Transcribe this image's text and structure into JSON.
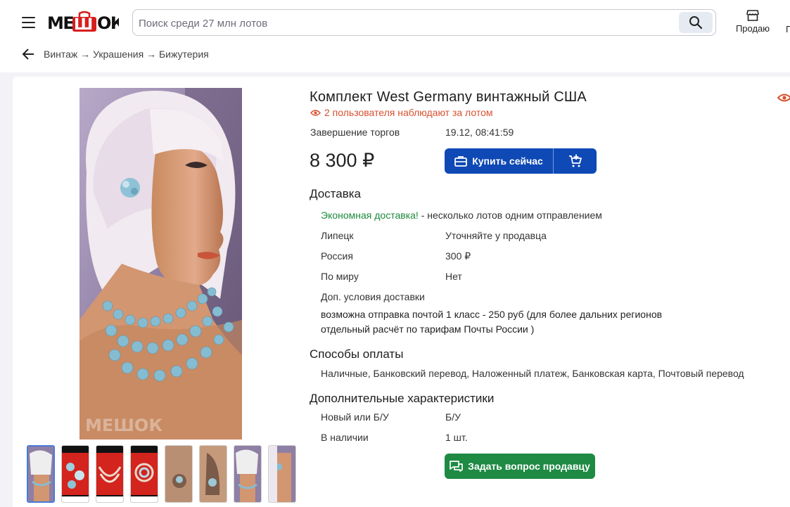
{
  "header": {
    "logo": "МЕШОК",
    "search_placeholder": "Поиск среди 27 млн лотов",
    "sell_label": "Продаю",
    "cutoff_label": "Г"
  },
  "breadcrumb": {
    "path": "Винтаж → Украшения → Бижутерия"
  },
  "lot": {
    "title": "Комплект West Germany винтажный США",
    "watchers": "2 пользователя наблюдают за лотом",
    "end_label": "Завершение торгов",
    "end_value": "19.12, 08:41:59",
    "price": "8 300 ₽",
    "buy_label": "Купить сейчас",
    "photo_watermark": "МЕШОК"
  },
  "delivery": {
    "heading": "Доставка",
    "economy_link": "Экономная доставка!",
    "economy_text": " - несколько лотов одним отправлением",
    "rows": [
      {
        "label": "Липецк",
        "value": "Уточняйте у продавца"
      },
      {
        "label": "Россия",
        "value": "300 ₽"
      },
      {
        "label": "По миру",
        "value": "Нет"
      }
    ],
    "extra_label": "Доп. условия доставки",
    "extra_line1": "возможна отправка почтой 1 класс - 250 руб (для более дальних регионов",
    "extra_line2": "отдельный расчёт по тарифам Почты России )"
  },
  "payment": {
    "heading": "Способы оплаты",
    "methods": "Наличные, Банковский перевод, Наложенный платеж, Банковская карта, Почтовый перевод"
  },
  "characteristics": {
    "heading": "Дополнительные характеристики",
    "rows": [
      {
        "label": "Новый или Б/У",
        "value": "Б/У"
      },
      {
        "label": "В наличии",
        "value": "1 шт."
      }
    ]
  },
  "ask_label": "Задать вопрос продавцу",
  "colors": {
    "accent_blue": "#0e49b5",
    "watch_orange": "#d8502f",
    "economy_green": "#1a8a3a",
    "ask_green": "#1e8a44",
    "logo_red": "#d81e1e"
  },
  "icons": [
    "menu-icon",
    "search-icon",
    "store-icon",
    "back-arrow-icon",
    "eye-icon",
    "briefcase-icon",
    "cart-plus-icon",
    "chat-icon"
  ]
}
